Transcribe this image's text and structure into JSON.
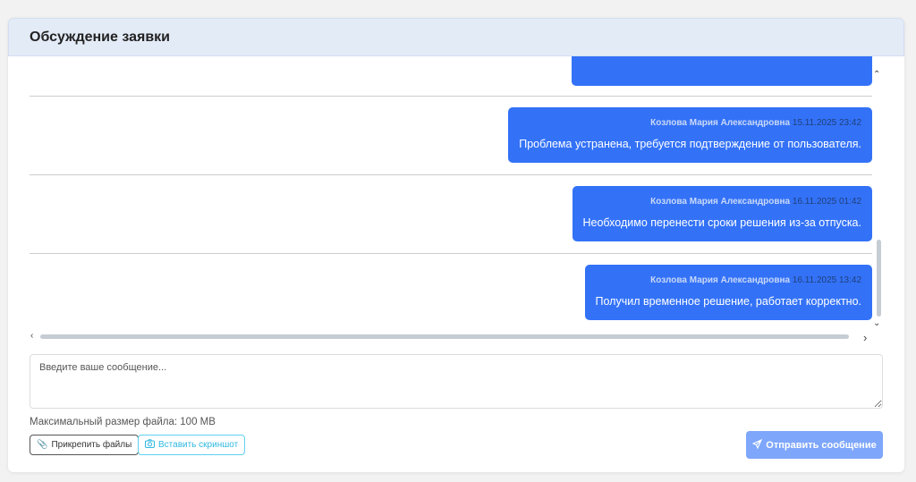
{
  "header": {
    "title": "Обсуждение заявки"
  },
  "messages": [
    {
      "author": "Козлова Мария Александровна",
      "time": "15.11.2025 23:42",
      "text": "Проблема устранена, требуется подтверждение от пользователя."
    },
    {
      "author": "Козлова Мария Александровна",
      "time": "16.11.2025 01:42",
      "text": "Необходимо перенести сроки решения из-за отпуска."
    },
    {
      "author": "Козлова Мария Александровна",
      "time": "16.11.2025 13:42",
      "text": "Получил временное решение, работает корректно."
    }
  ],
  "composer": {
    "placeholder": "Введите ваше сообщение...",
    "max_size": "Максимальный размер файла: 100 MB",
    "attach_label": "Прикрепить файлы",
    "screenshot_label": "Вставить скриншот",
    "send_label": "Отправить сообщение"
  },
  "colors": {
    "bubble": "#3372f7",
    "send": "#7ea6fa",
    "header": "#e3ebf7"
  }
}
